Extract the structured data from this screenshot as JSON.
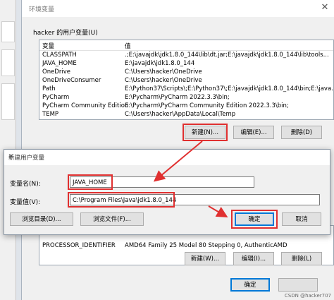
{
  "window": {
    "title": "环境变量",
    "close_glyph": "✕"
  },
  "user_vars": {
    "group_label": "hacker 的用户变量(U)",
    "headers": [
      "变量",
      "值"
    ],
    "rows": [
      {
        "name": "CLASSPATH",
        "value": ".;E:\\javajdk\\jdk1.8.0_144\\lib\\dt.jar;E:\\javajdk\\jdk1.8.0_144\\lib\\tools..."
      },
      {
        "name": "JAVA_HOME",
        "value": "E:\\javajdk\\jdk1.8.0_144"
      },
      {
        "name": "OneDrive",
        "value": "C:\\Users\\hacker\\OneDrive"
      },
      {
        "name": "OneDriveConsumer",
        "value": "C:\\Users\\hacker\\OneDrive"
      },
      {
        "name": "Path",
        "value": "E:\\Python37\\Scripts\\;E:\\Python37\\;E:\\javajdk\\jdk1.8.0_144\\bin;E:\\java..."
      },
      {
        "name": "PyCharm",
        "value": "E:\\Pycharm\\PyCharm 2022.3.3\\bin;"
      },
      {
        "name": "PyCharm Community Edition",
        "value": "E:\\Pycharm\\PyCharm Community Edition 2022.3.3\\bin;"
      },
      {
        "name": "TEMP",
        "value": "C:\\Users\\hacker\\AppData\\Local\\Temp"
      }
    ],
    "new_button": "新建(N)...",
    "edit_button": "编辑(E)...",
    "delete_button": "删除(D)"
  },
  "system_vars": {
    "rows": [
      {
        "name": "PROCESSOR_IDENTIFIER",
        "value": "AMD64 Family 25 Model 80 Stepping 0, AuthenticAMD"
      }
    ],
    "new_button": "新建(W)...",
    "edit_button": "编辑(I)...",
    "delete_button": "删除(L)"
  },
  "footer": {
    "ok_button": "确定",
    "watermark": "CSDN @hacker707"
  },
  "dialog": {
    "title": "新建用户变量",
    "close_glyph": "✕",
    "name_label": "变量名(N):",
    "name_value": "JAVA_HOME",
    "value_label": "变量值(V):",
    "value_value": "C:\\Program Files\\Java\\jdk1.8.0_144",
    "browse_dir_button": "浏览目录(D)...",
    "browse_file_button": "浏览文件(F)...",
    "ok_button": "确定",
    "cancel_button": "取消"
  },
  "colors": {
    "highlight": "#e03030",
    "accent": "#0078d7"
  }
}
